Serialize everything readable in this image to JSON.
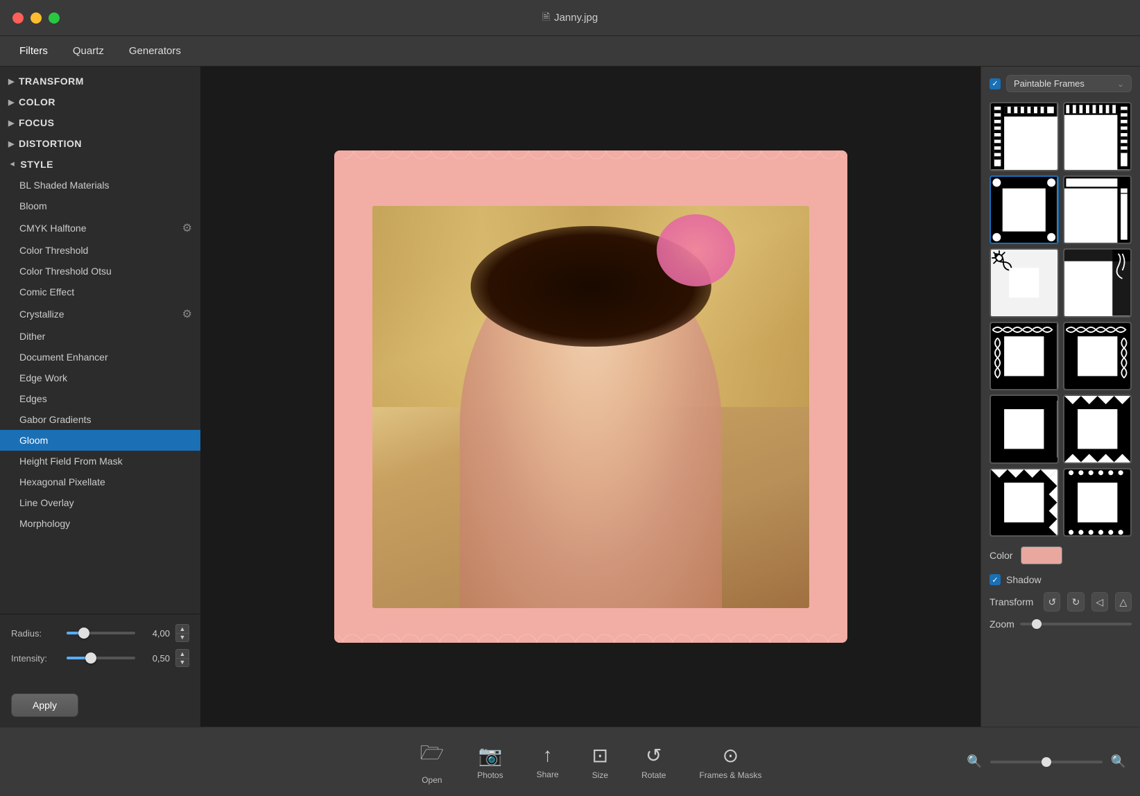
{
  "window": {
    "title": "Janny.jpg"
  },
  "tabs": [
    {
      "id": "filters",
      "label": "Filters",
      "active": true
    },
    {
      "id": "quartz",
      "label": "Quartz",
      "active": false
    },
    {
      "id": "generators",
      "label": "Generators",
      "active": false
    }
  ],
  "sidebar": {
    "categories": [
      {
        "id": "transform",
        "label": "TRANSFORM",
        "expanded": false
      },
      {
        "id": "color",
        "label": "COLOR",
        "expanded": false
      },
      {
        "id": "focus",
        "label": "FOCUS",
        "expanded": false
      },
      {
        "id": "distortion",
        "label": "DISTORTION",
        "expanded": false
      },
      {
        "id": "style",
        "label": "STYLE",
        "expanded": true
      }
    ],
    "style_items": [
      {
        "id": "bl-shaded",
        "label": "BL Shaded Materials",
        "selected": false,
        "has_gear": false
      },
      {
        "id": "bloom",
        "label": "Bloom",
        "selected": false,
        "has_gear": false
      },
      {
        "id": "cmyk",
        "label": "CMYK Halftone",
        "selected": false,
        "has_gear": true
      },
      {
        "id": "color-threshold",
        "label": "Color Threshold",
        "selected": false,
        "has_gear": false
      },
      {
        "id": "color-threshold-otsu",
        "label": "Color Threshold Otsu",
        "selected": false,
        "has_gear": false
      },
      {
        "id": "comic-effect",
        "label": "Comic Effect",
        "selected": false,
        "has_gear": false
      },
      {
        "id": "crystallize",
        "label": "Crystallize",
        "selected": false,
        "has_gear": true
      },
      {
        "id": "dither",
        "label": "Dither",
        "selected": false,
        "has_gear": false
      },
      {
        "id": "document-enhancer",
        "label": "Document Enhancer",
        "selected": false,
        "has_gear": false
      },
      {
        "id": "edge-work",
        "label": "Edge Work",
        "selected": false,
        "has_gear": false
      },
      {
        "id": "edges",
        "label": "Edges",
        "selected": false,
        "has_gear": false
      },
      {
        "id": "gabor-gradients",
        "label": "Gabor Gradients",
        "selected": false,
        "has_gear": false
      },
      {
        "id": "gloom",
        "label": "Gloom",
        "selected": true,
        "has_gear": false
      },
      {
        "id": "height-field",
        "label": "Height Field From Mask",
        "selected": false,
        "has_gear": false
      },
      {
        "id": "hexagonal",
        "label": "Hexagonal Pixellate",
        "selected": false,
        "has_gear": false
      },
      {
        "id": "line-overlay",
        "label": "Line Overlay",
        "selected": false,
        "has_gear": false
      },
      {
        "id": "morphology",
        "label": "Morphology",
        "selected": false,
        "has_gear": false
      }
    ]
  },
  "controls": {
    "radius_label": "Radius:",
    "radius_value": "4,00",
    "radius_pct": 25,
    "intensity_label": "Intensity:",
    "intensity_value": "0,50",
    "intensity_pct": 35
  },
  "apply_btn": "Apply",
  "right_panel": {
    "checkbox_checked": true,
    "dropdown_label": "Paintable Frames",
    "color_label": "Color",
    "shadow_label": "Shadow",
    "shadow_checked": true,
    "transform_label": "Transform",
    "zoom_label": "Zoom"
  },
  "toolbar": {
    "items": [
      {
        "id": "open",
        "label": "Open"
      },
      {
        "id": "photos",
        "label": "Photos"
      },
      {
        "id": "share",
        "label": "Share"
      },
      {
        "id": "size",
        "label": "Size"
      },
      {
        "id": "rotate",
        "label": "Rotate"
      },
      {
        "id": "frames-masks",
        "label": "Frames & Masks"
      }
    ]
  }
}
